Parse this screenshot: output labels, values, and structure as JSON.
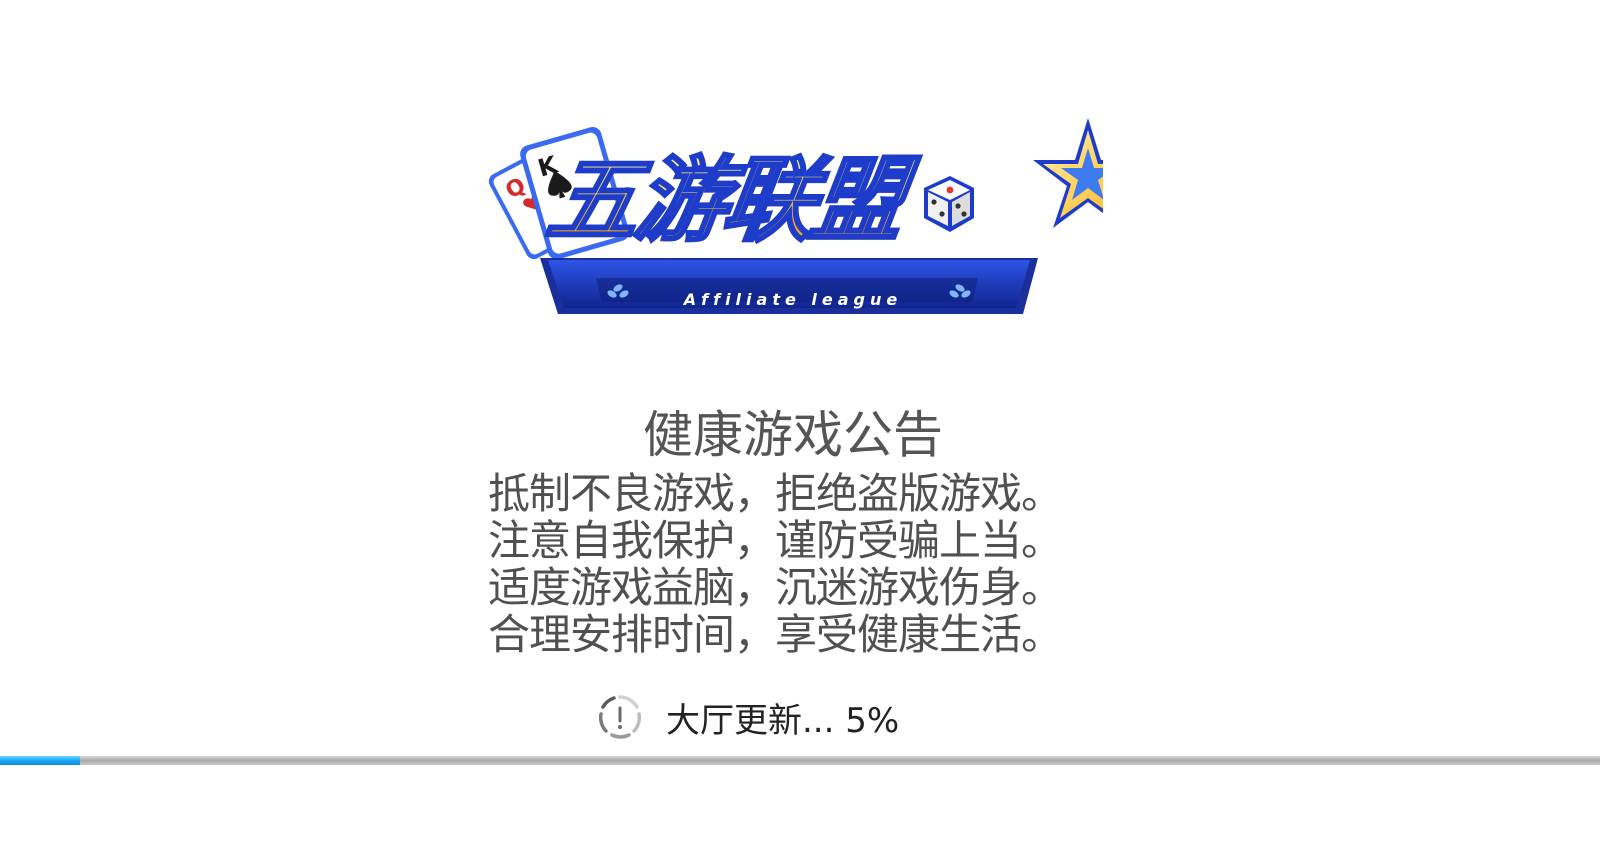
{
  "logo": {
    "title": "五游联盟",
    "subtitle": "Affiliate league",
    "card_k": "K",
    "card_q": "Q"
  },
  "notice": {
    "title": "健康游戏公告",
    "lines": [
      "抵制不良游戏，拒绝盗版游戏。",
      "注意自我保护，谨防受骗上当。",
      "适度游戏益脑，沉迷游戏伤身。",
      "合理安排时间，享受健康生活。"
    ]
  },
  "status": {
    "label": "大厅更新... 5%",
    "icon": "loading-spinner-icon"
  },
  "progress": {
    "percent": 5
  },
  "colors": {
    "background": "#ffffff",
    "text": "#505050",
    "progress_fill": "#17a8f4",
    "progress_track": "#b0b0b0",
    "logo_blue": "#1d3cc9",
    "logo_gold": "#ffc93a"
  }
}
